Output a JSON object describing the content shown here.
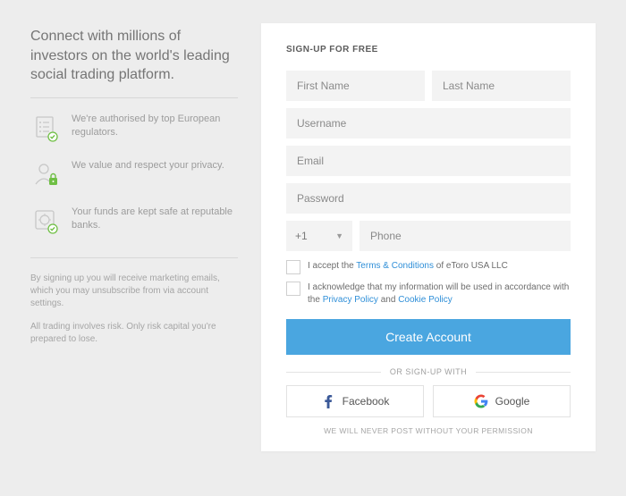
{
  "left": {
    "headline": "Connect with millions of investors on the world's leading social trading platform.",
    "features": [
      {
        "text": "We're authorised by top European regulators."
      },
      {
        "text": "We value and respect your privacy."
      },
      {
        "text": "Your funds are kept safe at reputable banks."
      }
    ],
    "fine1": "By signing up you will receive marketing emails, which you may unsubscribe from via account settings.",
    "fine2": "All trading involves risk. Only risk capital you're prepared to lose."
  },
  "form": {
    "title": "SIGN-UP FOR FREE",
    "first_name_ph": "First Name",
    "last_name_ph": "Last Name",
    "username_ph": "Username",
    "email_ph": "Email",
    "password_ph": "Password",
    "dial_code": "+1",
    "phone_ph": "Phone",
    "terms_pre": "I accept the ",
    "terms_link": "Terms & Conditions",
    "terms_post": " of eToro USA LLC",
    "ack_pre": "I acknowledge that my information will be used in accordance with the ",
    "privacy_link": "Privacy Policy",
    "ack_and": " and ",
    "cookie_link": "Cookie Policy",
    "submit_label": "Create Account",
    "or_label": "OR SIGN-UP WITH",
    "facebook_label": "Facebook",
    "google_label": "Google",
    "never_post": "WE WILL NEVER POST WITHOUT YOUR PERMISSION"
  },
  "colors": {
    "primary": "#4aa6e0",
    "link": "#2f8fd8",
    "accent_green": "#6fbf44",
    "facebook": "#3b5998"
  }
}
